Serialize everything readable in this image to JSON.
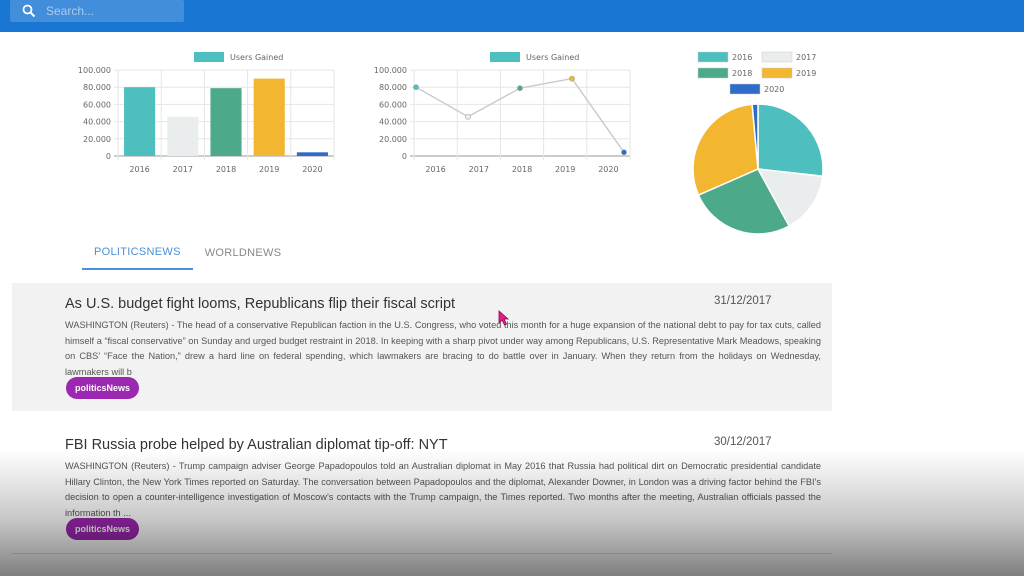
{
  "search": {
    "placeholder": "Search..."
  },
  "colors": {
    "header": "#1976d2",
    "tab_active": "#4a90d9",
    "badge": "#9c27b0",
    "teal": "#4dbfbe",
    "light": "#eaedee",
    "green": "#4caa8a",
    "yellow": "#f2b630",
    "blue": "#2f6bc8"
  },
  "chart_data": [
    {
      "type": "bar",
      "legend": [
        "Users Gained"
      ],
      "categories": [
        "2016",
        "2017",
        "2018",
        "2019",
        "2020"
      ],
      "values": [
        80000,
        45677,
        78888,
        90000,
        4300
      ],
      "bar_colors": [
        "#4dbfbe",
        "#eaedee",
        "#4caa8a",
        "#f2b630",
        "#2f6bc8"
      ],
      "ylim": [
        0,
        100000
      ],
      "y_ticks": [
        "100.000",
        "80.000",
        "60.000",
        "40.000",
        "20.000",
        "0"
      ],
      "grid": true
    },
    {
      "type": "line",
      "legend": [
        "Users Gained"
      ],
      "categories": [
        "2016",
        "2017",
        "2018",
        "2019",
        "2020"
      ],
      "values": [
        80000,
        45677,
        78888,
        90000,
        4300
      ],
      "ylim": [
        0,
        100000
      ],
      "y_ticks": [
        "100.000",
        "80.000",
        "60.000",
        "40.000",
        "20.000",
        "0"
      ],
      "grid": true
    },
    {
      "type": "pie",
      "labels": [
        "2016",
        "2017",
        "2018",
        "2019",
        "2020"
      ],
      "values": [
        80000,
        45677,
        78888,
        90000,
        4300
      ],
      "colors": [
        "#4dbfbe",
        "#eaedee",
        "#4caa8a",
        "#f2b630",
        "#2f6bc8"
      ],
      "legend_position": "top"
    }
  ],
  "tabs": [
    {
      "label": "POLITICSNEWS",
      "active": true
    },
    {
      "label": "WORLDNEWS",
      "active": false
    }
  ],
  "news": [
    {
      "title": "As U.S. budget fight looms, Republicans flip their fiscal script",
      "date": "31/12/2017",
      "body": "WASHINGTON (Reuters) - The head of a conservative Republican faction in the U.S. Congress, who voted this month for a huge expansion of the national debt to pay for tax cuts, called himself a “fiscal conservative” on Sunday and urged budget restraint in 2018. In keeping with a sharp pivot under way among Republicans, U.S. Representative Mark Meadows, speaking on CBS’ “Face the Nation,” drew a hard line on federal spending, which lawmakers are bracing to do battle over in January. When they return from the holidays on Wednesday, lawmakers will b",
      "badge": "politicsNews"
    },
    {
      "title": "FBI Russia probe helped by Australian diplomat tip-off: NYT",
      "date": "30/12/2017",
      "body": "WASHINGTON (Reuters) - Trump campaign adviser George Papadopoulos told an Australian diplomat in May 2016 that Russia had political dirt on Democratic presidential candidate Hillary Clinton, the New York Times reported on Saturday. The conversation between Papadopoulos and the diplomat, Alexander Downer, in London was a driving factor behind the FBI’s decision to open a counter-intelligence investigation of Moscow’s contacts with the Trump campaign, the Times reported. Two months after the meeting, Australian officials passed the information th ...",
      "badge": "politicsNews"
    }
  ]
}
